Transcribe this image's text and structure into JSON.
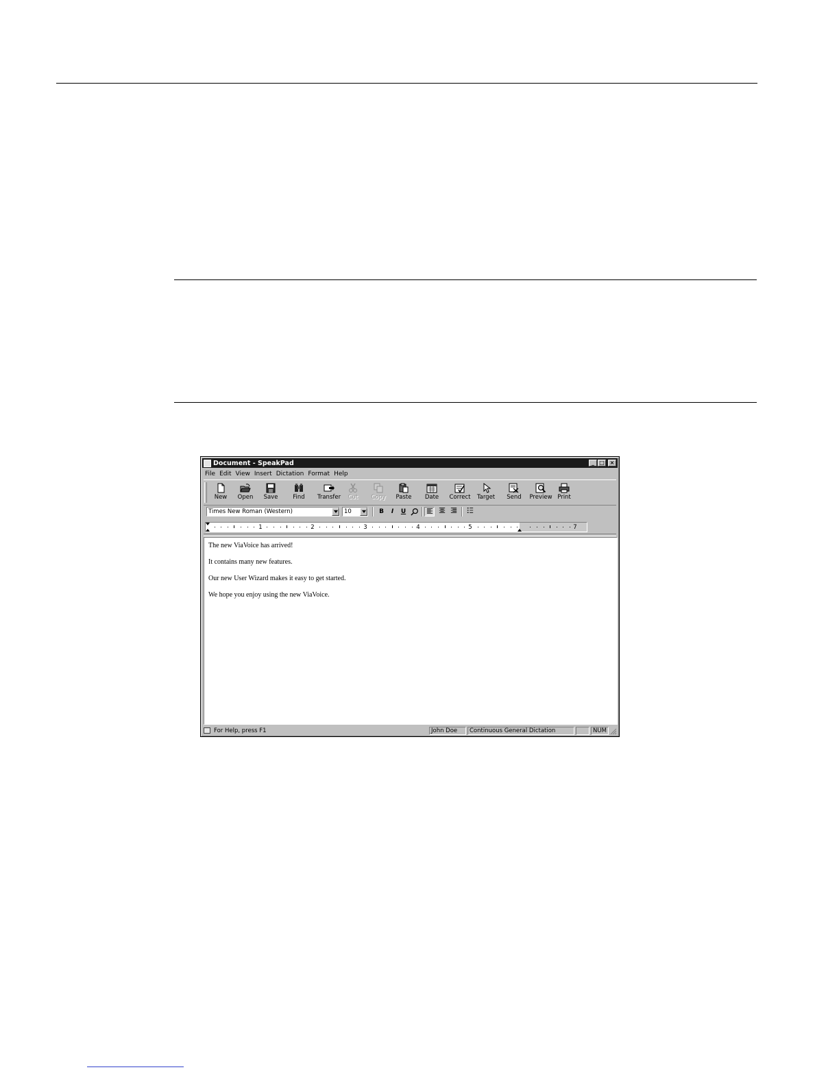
{
  "window": {
    "title": "Document - SpeakPad",
    "controls": {
      "minimize": "_",
      "maximize": "□",
      "close": "×"
    }
  },
  "menu": [
    "File",
    "Edit",
    "View",
    "Insert",
    "Dictation",
    "Format",
    "Help"
  ],
  "toolbar": {
    "buttons": [
      {
        "label": "New",
        "icon": "new-document-icon",
        "enabled": true
      },
      {
        "label": "Open",
        "icon": "open-folder-icon",
        "enabled": true
      },
      {
        "label": "Save",
        "icon": "floppy-disk-icon",
        "enabled": true
      },
      {
        "label": "Find",
        "icon": "binoculars-icon",
        "enabled": true
      },
      {
        "label": "Transfer",
        "icon": "transfer-icon",
        "enabled": true
      },
      {
        "label": "Cut",
        "icon": "scissors-icon",
        "enabled": false
      },
      {
        "label": "Copy",
        "icon": "copy-icon",
        "enabled": false
      },
      {
        "label": "Paste",
        "icon": "clipboard-icon",
        "enabled": true
      },
      {
        "label": "Date",
        "icon": "calendar-icon",
        "enabled": true
      },
      {
        "label": "Correct",
        "icon": "correct-icon",
        "enabled": true
      },
      {
        "label": "Target",
        "icon": "pointer-icon",
        "enabled": true
      },
      {
        "label": "Send",
        "icon": "send-icon",
        "enabled": true
      },
      {
        "label": "Preview",
        "icon": "magnifier-icon",
        "enabled": true
      },
      {
        "label": "Print",
        "icon": "printer-icon",
        "enabled": true
      }
    ]
  },
  "format": {
    "font": "Times New Roman (Western)",
    "size": "10",
    "bold": "B",
    "italic": "I",
    "underline": "U",
    "align_left_pressed": true
  },
  "ruler": {
    "numbers": [
      "1",
      "2",
      "3",
      "4",
      "5",
      "7"
    ]
  },
  "document": {
    "lines": [
      "The new ViaVoice has arrived!",
      "It contains many new features.",
      "Our new User Wizard makes it easy to get started.",
      "We hope you enjoy using the new ViaVoice."
    ]
  },
  "status": {
    "help": "For Help, press F1",
    "user": "John Doe",
    "mode": "Continuous General Dictation",
    "num": "NUM"
  }
}
